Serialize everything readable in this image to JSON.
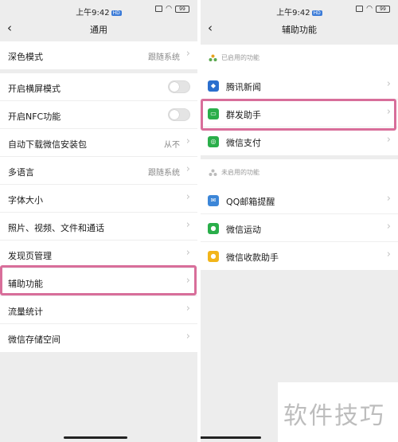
{
  "left": {
    "status": {
      "time": "上午9:42",
      "net": "HD",
      "battery": "99"
    },
    "nav": {
      "title": "通用"
    },
    "dark_mode": {
      "label": "深色模式",
      "value": "跟随系统"
    },
    "rows": [
      {
        "label": "开启横屏模式",
        "kind": "toggle"
      },
      {
        "label": "开启NFC功能",
        "kind": "toggle"
      },
      {
        "label": "自动下载微信安装包",
        "value": "从不"
      },
      {
        "label": "多语言",
        "value": "跟随系统"
      },
      {
        "label": "字体大小"
      },
      {
        "label": "照片、视频、文件和通话"
      },
      {
        "label": "发现页管理"
      },
      {
        "label": "辅助功能"
      },
      {
        "label": "流量统计"
      },
      {
        "label": "微信存储空间"
      }
    ]
  },
  "right": {
    "status": {
      "time": "上午9:42",
      "net": "HD",
      "battery": "99"
    },
    "nav": {
      "title": "辅助功能"
    },
    "enabled_header": "已启用的功能",
    "enabled": [
      {
        "label": "腾讯新闻",
        "icon": "news-icon",
        "color": "#2b6fce"
      },
      {
        "label": "群发助手",
        "icon": "broadcast-icon",
        "color": "#2aae4a"
      },
      {
        "label": "微信支付",
        "icon": "wechat-pay-icon",
        "color": "#2aae4a"
      }
    ],
    "disabled_header": "未启用的功能",
    "disabled": [
      {
        "label": "QQ邮箱提醒",
        "icon": "mail-icon",
        "color": "#3c86d8"
      },
      {
        "label": "微信运动",
        "icon": "sport-icon",
        "color": "#2aae4a"
      },
      {
        "label": "微信收款助手",
        "icon": "payment-assistant-icon",
        "color": "#f2b51a"
      }
    ]
  },
  "highlight_color": "#d86e9a",
  "watermark": "软件技巧"
}
